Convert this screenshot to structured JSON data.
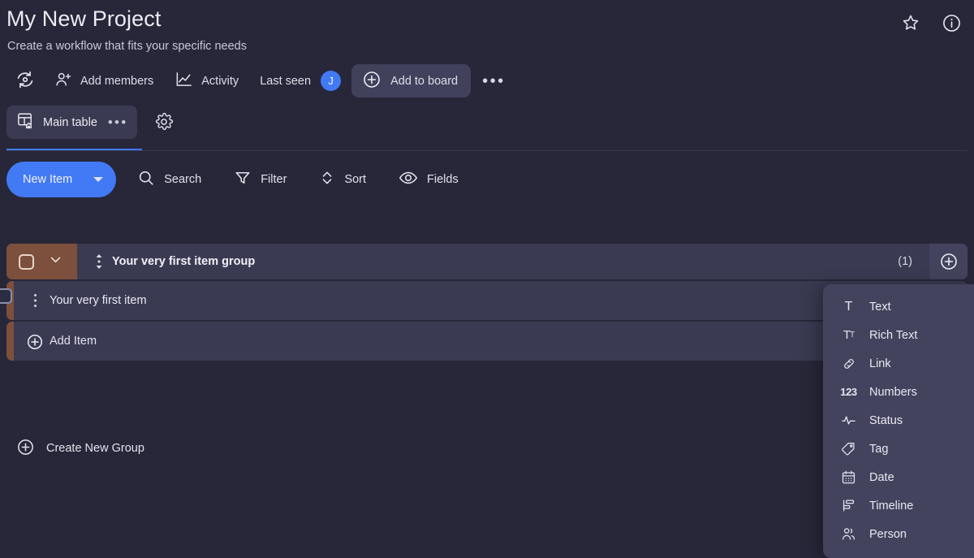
{
  "header": {
    "title": "My New Project",
    "subtitle": "Create a workflow that fits your specific needs",
    "favorite_icon": "star-icon",
    "info_icon": "info-icon"
  },
  "action_bar": {
    "sync_icon": "sync-icon",
    "add_members_label": "Add members",
    "add_members_icon": "person-add-icon",
    "activity_label": "Activity",
    "activity_icon": "activity-chart-icon",
    "last_seen_label": "Last seen",
    "last_seen_avatar": "J",
    "add_to_board_label": "Add to board",
    "add_to_board_icon": "plus-circle-icon",
    "more_label": "•••"
  },
  "tabs": {
    "main_table_label": "Main table",
    "main_table_icon": "board-home-icon",
    "main_table_more": "•••",
    "settings_icon": "gear-icon"
  },
  "toolbar": {
    "new_item_label": "New Item",
    "search_label": "Search",
    "search_icon": "search-icon",
    "filter_label": "Filter",
    "filter_icon": "funnel-icon",
    "sort_label": "Sort",
    "sort_icon": "sort-updown-icon",
    "fields_label": "Fields",
    "fields_icon": "eye-icon"
  },
  "board": {
    "group": {
      "title": "Your very first item group",
      "count": "(1)",
      "add_column_icon": "plus-circle-icon",
      "collapse_icon": "chevron-down-icon",
      "checkbox_icon": "checkbox-icon",
      "drag_icon": "drag-handle-icon",
      "accent_color": "#7c503c"
    },
    "rows": [
      {
        "label": "Your very first item",
        "drag_icon": "drag-handle-icon"
      }
    ],
    "add_item_label": "Add Item",
    "add_item_icon": "plus-circle-icon",
    "create_group_label": "Create New Group",
    "create_group_icon": "plus-circle-icon"
  },
  "column_type_menu": {
    "items": [
      {
        "label": "Text",
        "icon": "text-icon"
      },
      {
        "label": "Rich Text",
        "icon": "rich-text-icon"
      },
      {
        "label": "Link",
        "icon": "link-icon"
      },
      {
        "label": "Numbers",
        "icon": "numbers-icon"
      },
      {
        "label": "Status",
        "icon": "status-pulse-icon"
      },
      {
        "label": "Tag",
        "icon": "tag-icon"
      },
      {
        "label": "Date",
        "icon": "calendar-icon"
      },
      {
        "label": "Timeline",
        "icon": "timeline-icon"
      },
      {
        "label": "Person",
        "icon": "person-icon"
      }
    ]
  },
  "colors": {
    "page_background": "#272739",
    "row_background": "#3a3a52",
    "accent_blue": "#4279f5",
    "group_accent": "#7c503c",
    "menu_background": "#43435e"
  }
}
